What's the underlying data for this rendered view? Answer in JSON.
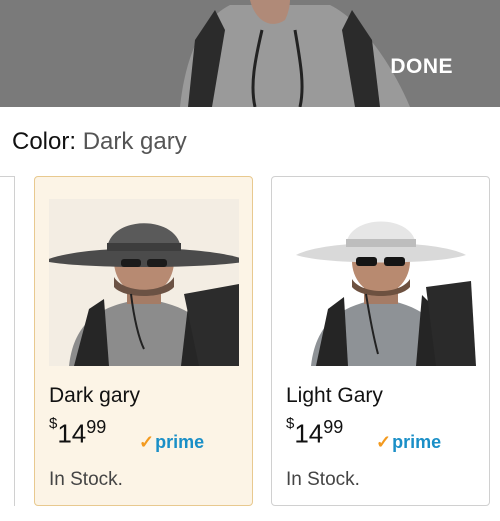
{
  "header": {
    "done_label": "DONE"
  },
  "color_selector": {
    "label": "Color:",
    "selected_value": "Dark gary"
  },
  "options": [
    {
      "name": "Dark gary",
      "price_symbol": "$",
      "price_whole": "14",
      "price_cents": "99",
      "prime_check": "✓",
      "prime_label": "prime",
      "stock": "In Stock.",
      "selected": true
    },
    {
      "name": "Light Gary",
      "price_symbol": "$",
      "price_whole": "14",
      "price_cents": "99",
      "prime_check": "✓",
      "prime_label": "prime",
      "stock": "In Stock.",
      "selected": false
    }
  ],
  "colors": {
    "prime_blue": "#1a8fc7",
    "prime_check": "#f39a1f",
    "selected_bg": "#fcf4e6",
    "selected_border": "#e8c98f"
  }
}
